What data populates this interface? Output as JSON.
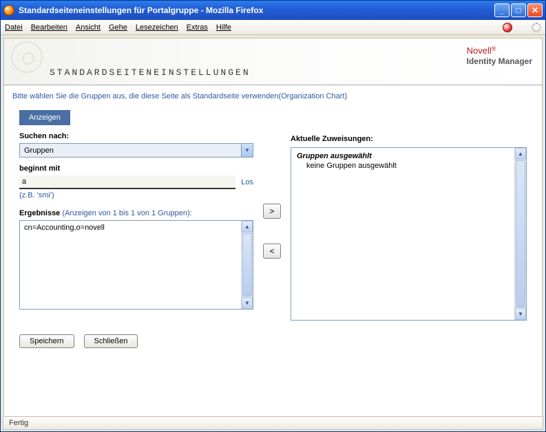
{
  "window": {
    "title": "Standardseiteneinstellungen für Portalgruppe - Mozilla Firefox"
  },
  "menus": {
    "datei": "Datei",
    "bearbeiten": "Bearbeiten",
    "ansicht": "Ansicht",
    "gehe": "Gehe",
    "lesezeichen": "Lesezeichen",
    "extras": "Extras",
    "hilfe": "Hilfe"
  },
  "brand": {
    "name": "Novell",
    "reg": "®",
    "sub": "Identity Manager"
  },
  "page": {
    "title": "STANDARDSEITENEINSTELLUNGEN",
    "instruction": "Bitte wählen Sie die Gruppen aus, die diese Seite als Standardseite verwenden(Organization Chart)"
  },
  "left": {
    "show_btn": "Anzeigen",
    "search_label": "Suchen nach:",
    "search_selected": "Gruppen",
    "begins_label": "beginnt mit",
    "begins_value": "a",
    "go": "Los",
    "hint": "(z.B. 'smi')",
    "results_label": "Ergebnisse",
    "results_sub": "(Anzeigen von 1 bis 1 von 1 Gruppen):",
    "result_item": "cn=Accounting,o=novell"
  },
  "right": {
    "label": "Aktuelle Zuweisungen:",
    "selected_hdr": "Gruppen ausgewählt",
    "empty_msg": "keine Gruppen ausgewählt"
  },
  "arrows": {
    "add": ">",
    "remove": "<"
  },
  "buttons": {
    "save": "Speichern",
    "close": "Schließen"
  },
  "status": "Fertig"
}
